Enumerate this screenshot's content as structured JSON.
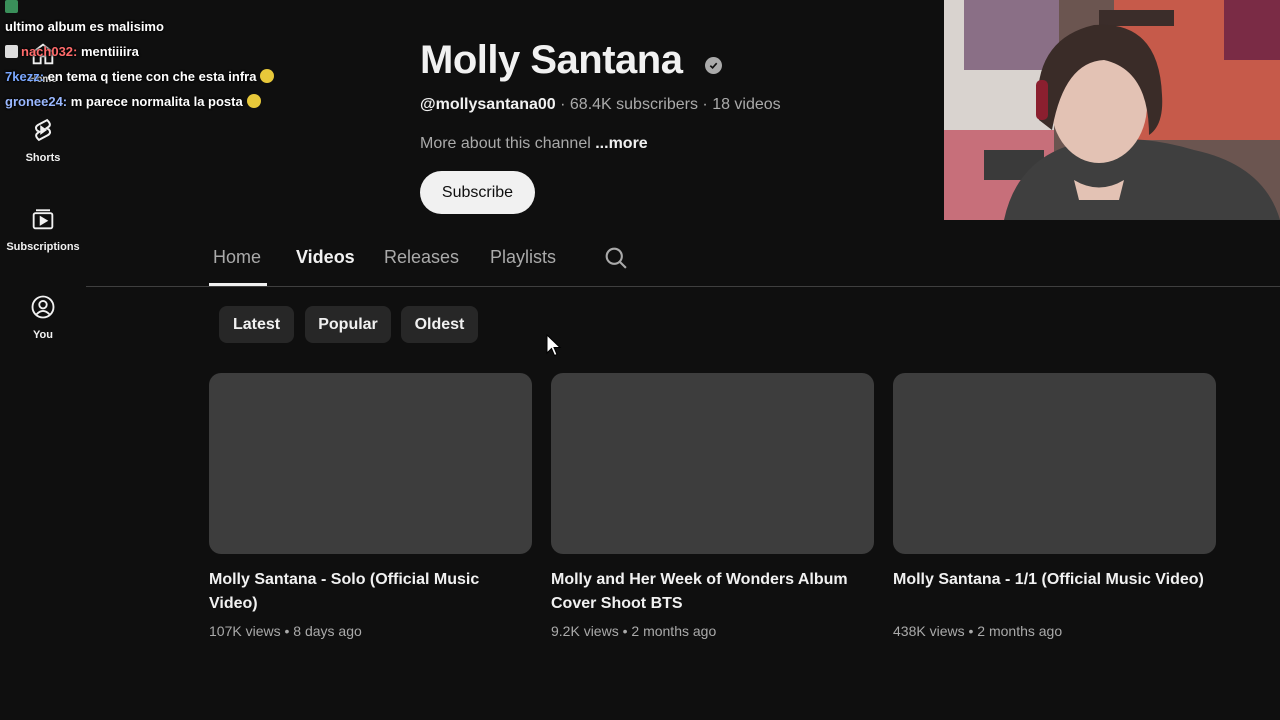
{
  "rail": {
    "home_label": "Home",
    "shorts_label": "Shorts",
    "subscriptions_label": "Subscriptions",
    "you_label": "You"
  },
  "chat": [
    {
      "user": "",
      "message": "ultimo album es malisimo"
    },
    {
      "user": "nach032:",
      "message": "mentiiiira"
    },
    {
      "user": "7kezz:",
      "message": "en tema q tiene con che esta infra"
    },
    {
      "user": "gronee24:",
      "message": "m parece normalita la posta"
    }
  ],
  "channel": {
    "name": "Molly Santana",
    "handle": "@mollysantana00",
    "subscribers": "68.4K subscribers",
    "videos_count": "18 videos",
    "separator": "·",
    "about": "More about this channel",
    "more": "...more",
    "subscribe_label": "Subscribe"
  },
  "tabs": [
    {
      "label": "Home"
    },
    {
      "label": "Videos"
    },
    {
      "label": "Releases"
    },
    {
      "label": "Playlists"
    }
  ],
  "active_tab": "Videos",
  "chips": [
    {
      "label": "Latest"
    },
    {
      "label": "Popular"
    },
    {
      "label": "Oldest"
    }
  ],
  "videos": [
    {
      "title": "Molly Santana - Solo (Official Music Video)",
      "views": "107K views",
      "age": "8 days ago"
    },
    {
      "title": "Molly and Her Week of Wonders Album Cover Shoot BTS",
      "views": "9.2K views",
      "age": "2 months ago"
    },
    {
      "title": "Molly Santana - 1/1 (Official Music Video)",
      "views": "438K views",
      "age": "2 months ago"
    }
  ],
  "colors": {
    "background": "#0f0f0f",
    "text_primary": "#f1f1f1",
    "text_secondary": "#aaaaaa",
    "chip_bg": "#272727",
    "thumb_placeholder": "#3d3d3d"
  }
}
